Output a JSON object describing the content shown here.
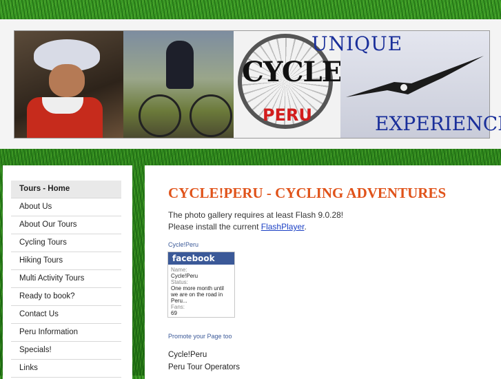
{
  "banner": {
    "logo_text": "CYCLE!",
    "logo_subtext": "PERU",
    "tagline_top": "UNIQUE",
    "tagline_bottom": "EXPERIENCE"
  },
  "nav": {
    "items": [
      {
        "label": "Tours - Home"
      },
      {
        "label": "About Us"
      },
      {
        "label": "About Our Tours"
      },
      {
        "label": "Cycling Tours"
      },
      {
        "label": "Hiking Tours"
      },
      {
        "label": "Multi Activity Tours"
      },
      {
        "label": "Ready to book?"
      },
      {
        "label": "Contact Us"
      },
      {
        "label": "Peru Information"
      },
      {
        "label": "Specials!"
      },
      {
        "label": "Links"
      }
    ]
  },
  "main": {
    "title": "CYCLE!PERU - CYCLING ADVENTURES",
    "flash_line1": "The photo gallery requires at least Flash 9.0.28!",
    "flash_line2_prefix": "Please install the current ",
    "flash_link": "FlashPlayer",
    "flash_line2_suffix": ".",
    "fb_page_link": "Cycle!Peru",
    "fb_badge": {
      "header": "facebook",
      "name_label": "Name:",
      "name_value": "Cycle!Peru",
      "status_label": "Status:",
      "status_value": "One more month until we are on the road in Peru...",
      "fans_label": "Fans:",
      "fans_value": "69"
    },
    "promote_link": "Promote your Page too",
    "bottom_links": [
      "Cycle!Peru",
      "Peru Tour Operators"
    ]
  }
}
